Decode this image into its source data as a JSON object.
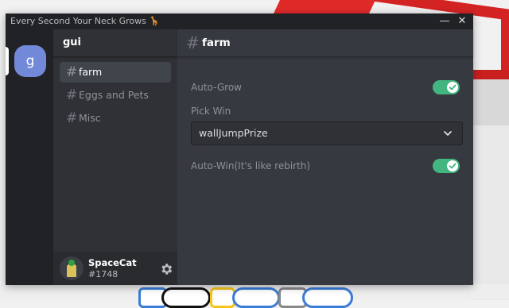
{
  "window": {
    "title": "Every Second Your Neck Grows",
    "title_emoji": "🦒",
    "minimize_label": "—",
    "close_label": "✕"
  },
  "server": {
    "initial": "g",
    "name": "gui",
    "accent_color": "#7289da"
  },
  "channels": [
    {
      "hash": "#",
      "label": "farm",
      "active": true
    },
    {
      "hash": "#",
      "label": "Eggs and Pets",
      "active": false
    },
    {
      "hash": "#",
      "label": "Misc",
      "active": false
    }
  ],
  "user": {
    "name": "SpaceCat",
    "tag": "#1748",
    "settings_icon": "gear-icon"
  },
  "main": {
    "hash": "#",
    "title": "farm",
    "auto_grow": {
      "label": "Auto-Grow",
      "enabled": true
    },
    "pick_win": {
      "label": "Pick Win",
      "selected": "wallJumpPrize"
    },
    "auto_win": {
      "label": "Auto-Win(It's like rebirth)",
      "enabled": true
    }
  },
  "colors": {
    "toggle_on": "#43b581",
    "background": "#36393f",
    "sidebar": "#2f3136",
    "rail": "#202225"
  }
}
